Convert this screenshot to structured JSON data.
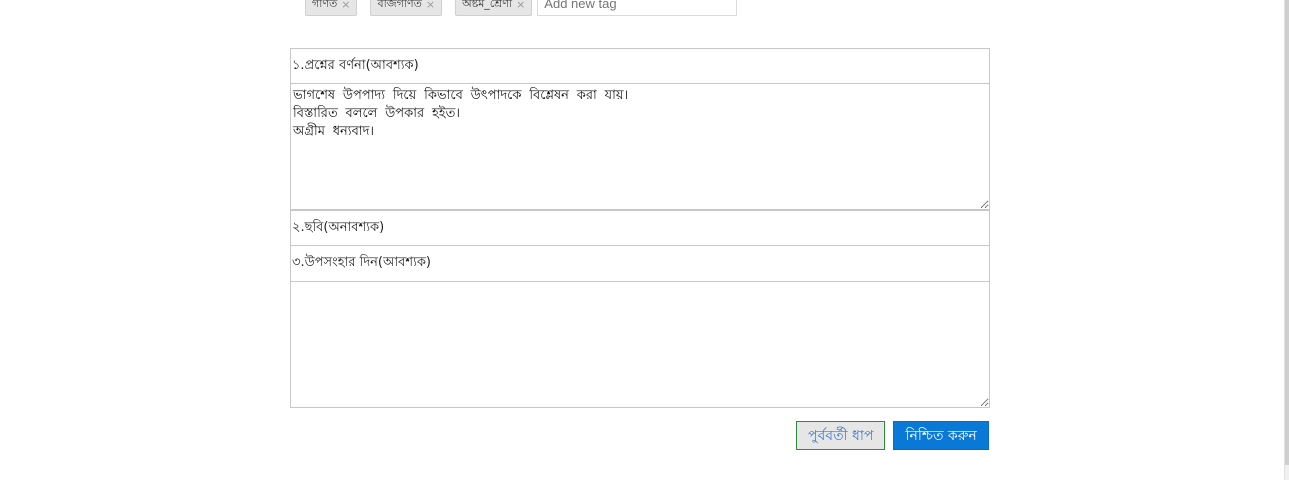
{
  "tags": {
    "items": [
      {
        "label": "গণিত",
        "remove": "×"
      },
      {
        "label": "বীজগণিত",
        "remove": "×"
      },
      {
        "label": "অষ্টম_শ্রেণী",
        "remove": "×"
      }
    ],
    "new_tag_placeholder": "Add new tag"
  },
  "form": {
    "q1_label": "১.প্রশ্নের বর্ণনা(আবশ্যক)",
    "q1_value": "ভাগশেষ উপপাদ্য দিয়ে কিভাবে উৎপাদকে বিশ্লেষন করা যায়।\nবিস্তারিত বললে উপকার হইত।\nঅগ্রীম ধন্যবাদ।",
    "q2_label": "২.ছবি(অনাবশ্যক)",
    "q3_label": "৩.উপসংহার দিন(আবশ্যক)",
    "q3_value": ""
  },
  "buttons": {
    "previous_label": "পুর্ববর্তী ধাপ",
    "confirm_label": "নিশ্চিত করুন"
  }
}
